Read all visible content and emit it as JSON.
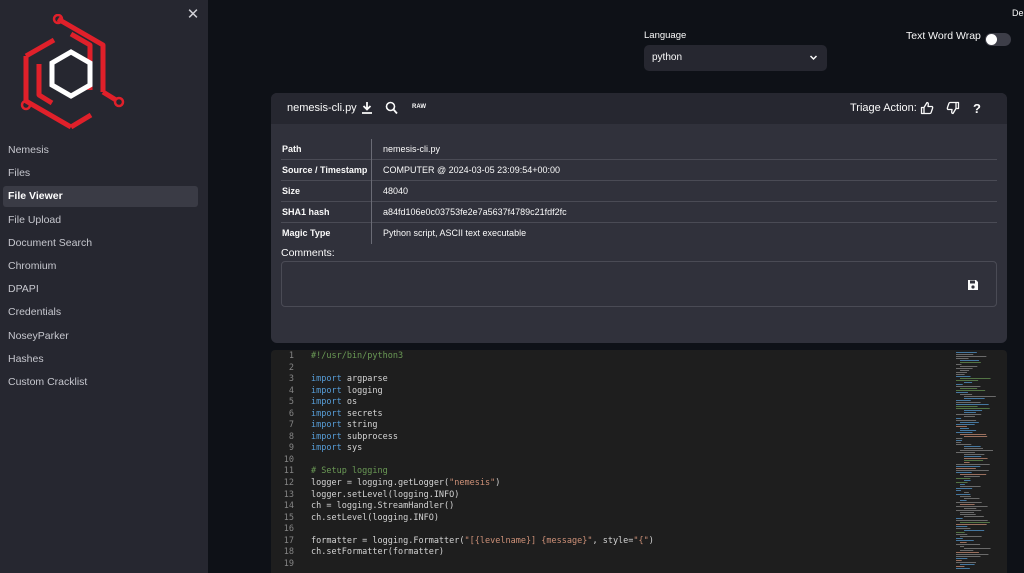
{
  "sidebar": {
    "close_icon": "close-icon",
    "items": [
      {
        "label": "Nemesis",
        "active": false
      },
      {
        "label": "Files",
        "active": false
      },
      {
        "label": "File Viewer",
        "active": true
      },
      {
        "label": "File Upload",
        "active": false
      },
      {
        "label": "Document Search",
        "active": false
      },
      {
        "label": "Chromium",
        "active": false
      },
      {
        "label": "DPAPI",
        "active": false
      },
      {
        "label": "Credentials",
        "active": false
      },
      {
        "label": "NoseyParker",
        "active": false
      },
      {
        "label": "Hashes",
        "active": false
      },
      {
        "label": "Custom Cracklist",
        "active": false
      }
    ]
  },
  "header": {
    "deploy_label": "Deploy"
  },
  "language": {
    "label": "Language",
    "selected": "python"
  },
  "wrap": {
    "label": "Text Word Wrap",
    "enabled": false
  },
  "file": {
    "name": "nemesis-cli.py",
    "raw_label": "RAW",
    "triage_label": "Triage Action:",
    "meta": [
      {
        "key": "Path",
        "value": "nemesis-cli.py"
      },
      {
        "key": "Source / Timestamp",
        "value": "COMPUTER @ 2024-03-05 23:09:54+00:00"
      },
      {
        "key": "Size",
        "value": "48040"
      },
      {
        "key": "SHA1 hash",
        "value": "a84fd106e0c03753fe2e7a5637f4789c21fdf2fc"
      },
      {
        "key": "Magic Type",
        "value": "Python script, ASCII text executable"
      }
    ],
    "comments_label": "Comments:"
  },
  "code": {
    "lines": [
      {
        "n": "1",
        "tokens": [
          {
            "t": "#!/usr/bin/python3",
            "c": "cm"
          }
        ]
      },
      {
        "n": "2",
        "tokens": []
      },
      {
        "n": "3",
        "tokens": [
          {
            "t": "import",
            "c": "kw"
          },
          {
            "t": " argparse",
            "c": ""
          }
        ]
      },
      {
        "n": "4",
        "tokens": [
          {
            "t": "import",
            "c": "kw"
          },
          {
            "t": " logging",
            "c": ""
          }
        ]
      },
      {
        "n": "5",
        "tokens": [
          {
            "t": "import",
            "c": "kw"
          },
          {
            "t": " os",
            "c": ""
          }
        ]
      },
      {
        "n": "6",
        "tokens": [
          {
            "t": "import",
            "c": "kw"
          },
          {
            "t": " secrets",
            "c": ""
          }
        ]
      },
      {
        "n": "7",
        "tokens": [
          {
            "t": "import",
            "c": "kw"
          },
          {
            "t": " string",
            "c": ""
          }
        ]
      },
      {
        "n": "8",
        "tokens": [
          {
            "t": "import",
            "c": "kw"
          },
          {
            "t": " subprocess",
            "c": ""
          }
        ]
      },
      {
        "n": "9",
        "tokens": [
          {
            "t": "import",
            "c": "kw"
          },
          {
            "t": " sys",
            "c": ""
          }
        ]
      },
      {
        "n": "10",
        "tokens": []
      },
      {
        "n": "11",
        "tokens": [
          {
            "t": "# Setup logging",
            "c": "cm"
          }
        ]
      },
      {
        "n": "12",
        "tokens": [
          {
            "t": "logger = logging.getLogger(",
            "c": ""
          },
          {
            "t": "\"nemesis\"",
            "c": "st"
          },
          {
            "t": ")",
            "c": ""
          }
        ]
      },
      {
        "n": "13",
        "tokens": [
          {
            "t": "logger.setLevel(logging.INFO)",
            "c": ""
          }
        ]
      },
      {
        "n": "14",
        "tokens": [
          {
            "t": "ch = logging.StreamHandler()",
            "c": ""
          }
        ]
      },
      {
        "n": "15",
        "tokens": [
          {
            "t": "ch.setLevel(logging.INFO)",
            "c": ""
          }
        ]
      },
      {
        "n": "16",
        "tokens": []
      },
      {
        "n": "17",
        "tokens": [
          {
            "t": "formatter = logging.Formatter(",
            "c": ""
          },
          {
            "t": "\"[{levelname}] {message}\"",
            "c": "st"
          },
          {
            "t": ", style=",
            "c": ""
          },
          {
            "t": "\"{\"",
            "c": "st"
          },
          {
            "t": ")",
            "c": ""
          }
        ]
      },
      {
        "n": "18",
        "tokens": [
          {
            "t": "ch.setFormatter(formatter)",
            "c": ""
          }
        ]
      },
      {
        "n": "19",
        "tokens": []
      }
    ]
  },
  "colors": {
    "app_bg": "#0e1117",
    "sidebar_bg": "#262730",
    "logo_red": "#e0202a",
    "editor_bg": "#1e1e1e",
    "keyword": "#569cd6",
    "comment": "#6a9955",
    "string": "#ce9178"
  }
}
